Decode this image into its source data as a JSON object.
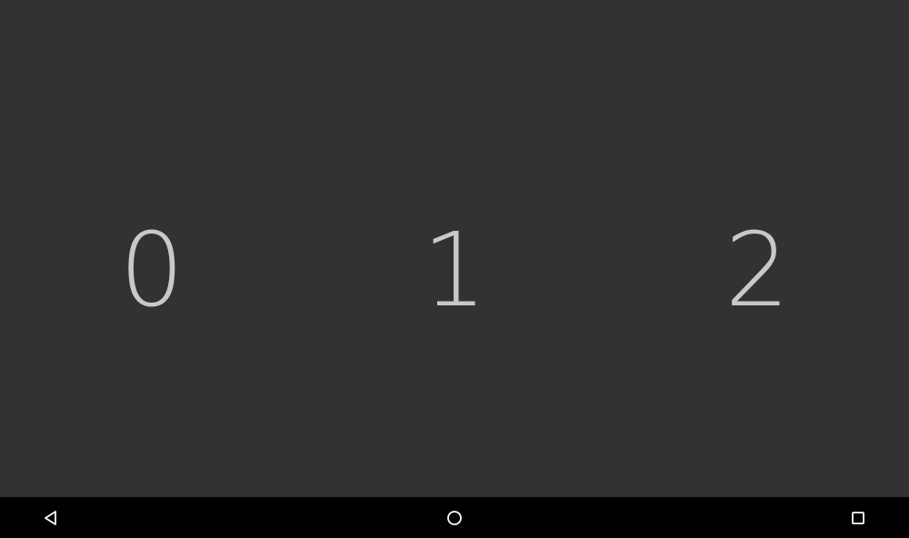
{
  "picker": {
    "values": [
      "0",
      "1",
      "2"
    ]
  },
  "navigation_bar": {
    "back": {
      "icon": "back-triangle-icon"
    },
    "home": {
      "icon": "home-circle-icon"
    },
    "recents": {
      "icon": "recents-square-icon"
    }
  },
  "colors": {
    "background": "#323232",
    "digit": "#c8c8c8",
    "navbar": "#000000",
    "nav_icon": "#ffffff"
  }
}
